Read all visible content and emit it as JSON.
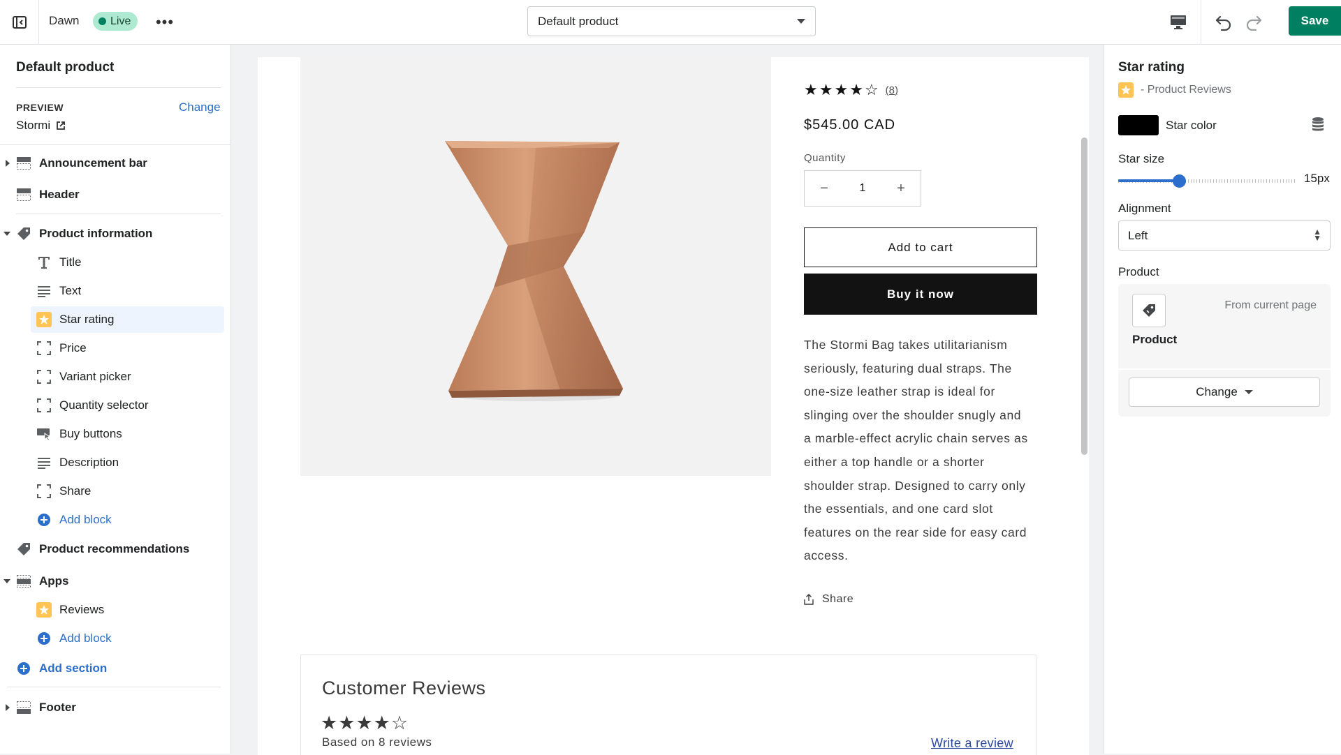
{
  "topbar": {
    "theme_name": "Dawn",
    "live_label": "Live",
    "more_label": "•••",
    "template_select": "Default product",
    "save_label": "Save"
  },
  "sidebar": {
    "title": "Default product",
    "preview_label": "PREVIEW",
    "preview_change": "Change",
    "preview_value": "Stormi",
    "sections": {
      "announcement_bar": "Announcement bar",
      "header": "Header",
      "product_information": "Product information",
      "product_recommendations": "Product recommendations",
      "apps": "Apps",
      "footer": "Footer"
    },
    "blocks": {
      "title": "Title",
      "text": "Text",
      "star_rating": "Star rating",
      "price": "Price",
      "variant_picker": "Variant picker",
      "quantity_selector": "Quantity selector",
      "buy_buttons": "Buy buttons",
      "description": "Description",
      "share": "Share",
      "add_block": "Add block"
    },
    "apps_blocks": {
      "reviews": "Reviews",
      "add_block": "Add block"
    },
    "add_section": "Add section"
  },
  "preview": {
    "rating_stars": [
      "★",
      "★",
      "★",
      "★",
      "☆"
    ],
    "rating_count": "(8)",
    "price": "$545.00 CAD",
    "quantity_label": "Quantity",
    "quantity_minus": "−",
    "quantity_value": "1",
    "quantity_plus": "+",
    "add_to_cart": "Add to cart",
    "buy_now": "Buy it now",
    "description_lines": [
      "The Stormi Bag takes utilitarianism",
      "seriously, featuring dual straps. The",
      "one-size leather strap is ideal for",
      "slinging over the shoulder snugly and",
      "a marble-effect acrylic chain serves as",
      "either a top handle or a shorter",
      "shoulder strap. Designed to carry only",
      "the essentials, and one card slot",
      "features on the rear side for easy card",
      "access."
    ],
    "share_label": "Share",
    "reviews": {
      "title": "Customer Reviews",
      "stars": [
        "★",
        "★",
        "★",
        "★",
        "☆"
      ],
      "based_on": "Based on 8 reviews",
      "write_review": "Write a review"
    },
    "product_color": "#c9916d"
  },
  "settings": {
    "title": "Star rating",
    "subtitle": "- Product Reviews",
    "star_color_label": "Star color",
    "star_color": "#000000",
    "star_size_label": "Star size",
    "star_size_value": "15px",
    "star_size_fraction": 0.34,
    "alignment_label": "Alignment",
    "alignment_value": "Left",
    "product_label": "Product",
    "product_source": "From current page",
    "product_name": "Product",
    "change_label": "Change"
  },
  "colors": {
    "accent": "#2c6ecb",
    "save": "#008060",
    "live_badge": "#aee9d1",
    "selected_row": "#edf4fe",
    "star_badge": "#ffc453"
  },
  "icons": [
    "exit-icon",
    "more-icon",
    "desktop-icon",
    "undo-icon",
    "redo-icon",
    "external-link-icon",
    "section-icon",
    "tag-icon",
    "title-icon",
    "text-icon",
    "star-icon",
    "block-icon",
    "buy-buttons-icon",
    "plus-circle-icon",
    "share-icon",
    "database-icon",
    "product-tag-icon"
  ]
}
